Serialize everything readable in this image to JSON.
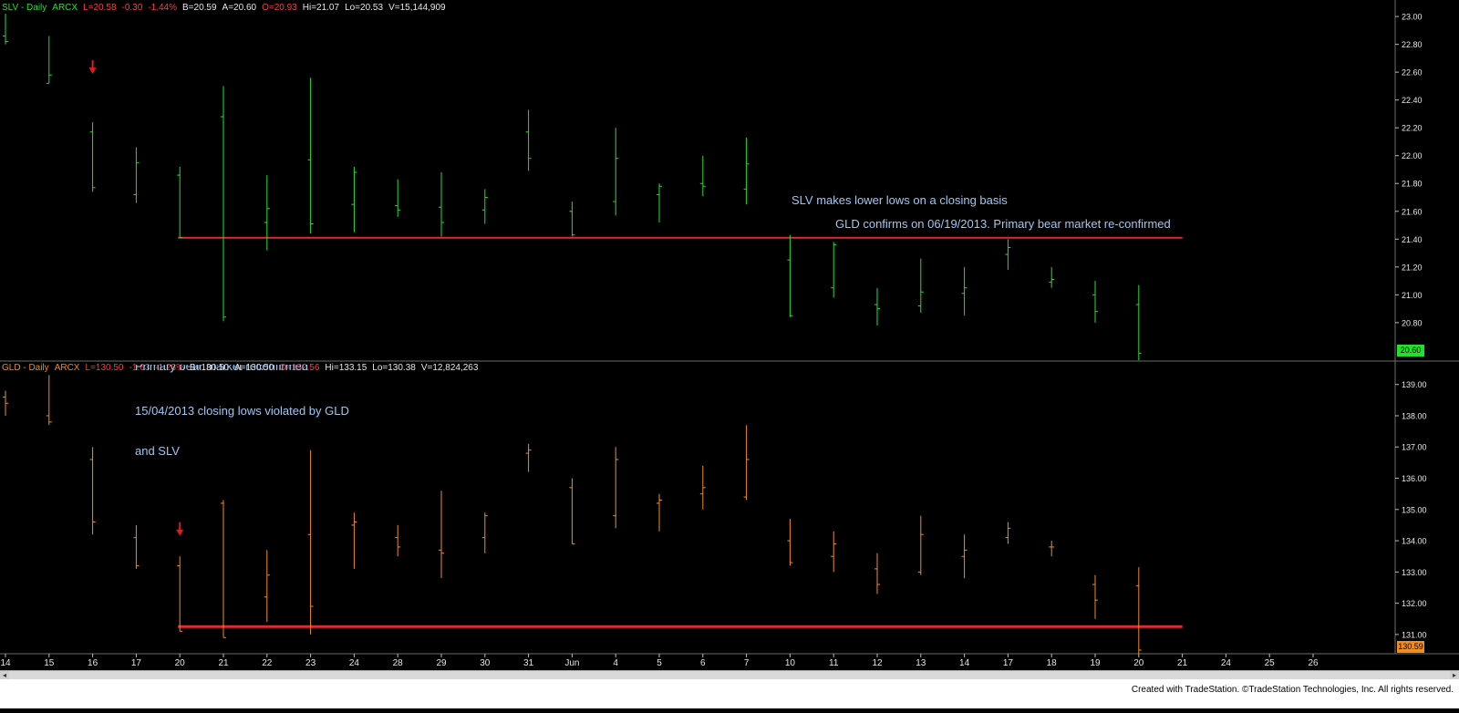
{
  "colors": {
    "background": "#000000",
    "slv_bar": "#23e02a",
    "gld_bar": "#f28c1e",
    "support_line": "#e12b2b",
    "arrow": "#e01b1b",
    "annotation": "#9fc7f2",
    "axis_text": "#e6e6e6",
    "grid": "#1f1f1f",
    "slv_tag": "#23e02a",
    "gld_tag": "#f28c1e"
  },
  "slv_header": {
    "symbol": "SLV - Daily",
    "exchange": "ARCX",
    "last": "L=20.58",
    "change": "-0.30",
    "pct": "-1.44%",
    "bid": "B=20.59",
    "ask": "A=20.60",
    "open": "O=20.93",
    "high": "Hi=21.07",
    "low": "Lo=20.53",
    "volume": "V=15,144,909"
  },
  "gld_header": {
    "symbol": "GLD - Daily",
    "exchange": "ARCX",
    "last": "L=130.50",
    "change": "-1.63",
    "pct": "-1.23%",
    "bid": "B=130.50",
    "ask": "A=130.50",
    "open": "O=132.56",
    "high": "Hi=133.15",
    "low": "Lo=130.38",
    "volume": "V=12,824,263"
  },
  "annotations": {
    "slv_line1": "SLV makes lower lows on a closing basis",
    "slv_line2": "GLD confirms on 06/19/2013. Primary bear market re-confirmed",
    "gld_line0": "Primary bear market reconfirmed",
    "gld_line1": "15/04/2013 closing lows violated by GLD",
    "gld_line2": "and SLV"
  },
  "price_tags": {
    "slv": "20.60",
    "gld": "130.59"
  },
  "footer": {
    "credit": "Created with TradeStation. ©TradeStation Technologies, Inc. All rights reserved."
  },
  "chart_data": [
    {
      "type": "ohlc",
      "symbol": "SLV - Daily",
      "x_labels": [
        "14",
        "15",
        "16",
        "17",
        "20",
        "21",
        "22",
        "23",
        "24",
        "28",
        "29",
        "30",
        "31",
        "Jun",
        "4",
        "5",
        "6",
        "7",
        "10",
        "11",
        "12",
        "13",
        "14",
        "17",
        "18",
        "19",
        "20",
        "21",
        "24",
        "25",
        "26"
      ],
      "y_ticks": [
        20.8,
        21.0,
        21.2,
        21.4,
        21.6,
        21.8,
        22.0,
        22.2,
        22.4,
        22.6,
        22.8,
        23.0
      ],
      "ylim": [
        20.55,
        23.04
      ],
      "bars": [
        {
          "x": 0,
          "o": 22.86,
          "h": 23.02,
          "l": 22.8,
          "c": 22.82
        },
        {
          "x": 1,
          "o": 22.52,
          "h": 22.86,
          "l": 22.52,
          "c": 22.58
        },
        {
          "x": 2,
          "o": 22.17,
          "h": 22.24,
          "l": 21.74,
          "c": 21.77
        },
        {
          "x": 3,
          "o": 21.72,
          "h": 22.06,
          "l": 21.66,
          "c": 21.95
        },
        {
          "x": 4,
          "o": 21.86,
          "h": 21.92,
          "l": 21.41,
          "c": 21.41
        },
        {
          "x": 5,
          "o": 22.28,
          "h": 22.5,
          "l": 20.81,
          "c": 20.84
        },
        {
          "x": 6,
          "o": 21.52,
          "h": 21.86,
          "l": 21.32,
          "c": 21.62
        },
        {
          "x": 7,
          "o": 21.97,
          "h": 22.56,
          "l": 21.44,
          "c": 21.51
        },
        {
          "x": 8,
          "o": 21.65,
          "h": 21.92,
          "l": 21.45,
          "c": 21.88
        },
        {
          "x": 9,
          "o": 21.64,
          "h": 21.83,
          "l": 21.56,
          "c": 21.61
        },
        {
          "x": 10,
          "o": 21.63,
          "h": 21.88,
          "l": 21.42,
          "c": 21.52
        },
        {
          "x": 11,
          "o": 21.61,
          "h": 21.76,
          "l": 21.51,
          "c": 21.7
        },
        {
          "x": 12,
          "o": 22.17,
          "h": 22.33,
          "l": 21.89,
          "c": 21.98
        },
        {
          "x": 13,
          "o": 21.6,
          "h": 21.67,
          "l": 21.42,
          "c": 21.43
        },
        {
          "x": 14,
          "o": 21.67,
          "h": 22.2,
          "l": 21.57,
          "c": 21.98
        },
        {
          "x": 15,
          "o": 21.72,
          "h": 21.8,
          "l": 21.52,
          "c": 21.78
        },
        {
          "x": 16,
          "o": 21.8,
          "h": 22.0,
          "l": 21.71,
          "c": 21.78
        },
        {
          "x": 17,
          "o": 21.76,
          "h": 22.13,
          "l": 21.65,
          "c": 21.94
        },
        {
          "x": 18,
          "o": 21.25,
          "h": 21.43,
          "l": 20.84,
          "c": 20.85
        },
        {
          "x": 19,
          "o": 21.05,
          "h": 21.38,
          "l": 20.98,
          "c": 21.36
        },
        {
          "x": 20,
          "o": 20.93,
          "h": 21.05,
          "l": 20.78,
          "c": 20.9
        },
        {
          "x": 21,
          "o": 20.92,
          "h": 21.26,
          "l": 20.87,
          "c": 21.02
        },
        {
          "x": 22,
          "o": 21.01,
          "h": 21.2,
          "l": 20.85,
          "c": 21.05
        },
        {
          "x": 23,
          "o": 21.29,
          "h": 21.4,
          "l": 21.18,
          "c": 21.34
        },
        {
          "x": 24,
          "o": 21.09,
          "h": 21.2,
          "l": 21.05,
          "c": 21.11
        },
        {
          "x": 25,
          "o": 21.0,
          "h": 21.1,
          "l": 20.8,
          "c": 20.88
        },
        {
          "x": 26,
          "o": 20.93,
          "h": 21.07,
          "l": 20.53,
          "c": 20.58
        }
      ],
      "support_level": 21.41,
      "support_from_x": 4,
      "support_to_x": 27,
      "arrow_at_x": 2,
      "arrow_price": 22.62
    },
    {
      "type": "ohlc",
      "symbol": "GLD - Daily",
      "x_labels": [
        "14",
        "15",
        "16",
        "17",
        "20",
        "21",
        "22",
        "23",
        "24",
        "28",
        "29",
        "30",
        "31",
        "Jun",
        "4",
        "5",
        "6",
        "7",
        "10",
        "11",
        "12",
        "13",
        "14",
        "17",
        "18",
        "19",
        "20",
        "21",
        "24",
        "25",
        "26"
      ],
      "y_ticks": [
        131.0,
        132.0,
        133.0,
        134.0,
        135.0,
        136.0,
        137.0,
        138.0,
        139.0
      ],
      "ylim": [
        130.5,
        139.4
      ],
      "bars": [
        {
          "x": 0,
          "o": 138.6,
          "h": 138.8,
          "l": 138.0,
          "c": 138.4
        },
        {
          "x": 1,
          "o": 138.0,
          "h": 139.3,
          "l": 137.7,
          "c": 137.8
        },
        {
          "x": 2,
          "o": 136.6,
          "h": 137.0,
          "l": 134.2,
          "c": 134.6
        },
        {
          "x": 3,
          "o": 134.1,
          "h": 134.5,
          "l": 133.1,
          "c": 133.2
        },
        {
          "x": 4,
          "o": 133.2,
          "h": 133.5,
          "l": 131.1,
          "c": 131.1
        },
        {
          "x": 5,
          "o": 135.2,
          "h": 135.3,
          "l": 130.9,
          "c": 130.9
        },
        {
          "x": 6,
          "o": 132.2,
          "h": 133.7,
          "l": 131.4,
          "c": 132.9
        },
        {
          "x": 7,
          "o": 134.2,
          "h": 136.9,
          "l": 131.0,
          "c": 131.9
        },
        {
          "x": 8,
          "o": 134.5,
          "h": 134.9,
          "l": 133.1,
          "c": 134.6
        },
        {
          "x": 9,
          "o": 134.1,
          "h": 134.5,
          "l": 133.5,
          "c": 133.8
        },
        {
          "x": 10,
          "o": 133.7,
          "h": 135.6,
          "l": 132.8,
          "c": 133.6
        },
        {
          "x": 11,
          "o": 134.1,
          "h": 134.9,
          "l": 133.6,
          "c": 134.8
        },
        {
          "x": 12,
          "o": 136.8,
          "h": 137.1,
          "l": 136.2,
          "c": 136.9
        },
        {
          "x": 13,
          "o": 135.7,
          "h": 136.0,
          "l": 133.9,
          "c": 133.9
        },
        {
          "x": 14,
          "o": 134.8,
          "h": 137.0,
          "l": 134.4,
          "c": 136.6
        },
        {
          "x": 15,
          "o": 135.2,
          "h": 135.5,
          "l": 134.3,
          "c": 135.3
        },
        {
          "x": 16,
          "o": 135.5,
          "h": 136.4,
          "l": 135.0,
          "c": 135.7
        },
        {
          "x": 17,
          "o": 135.4,
          "h": 137.7,
          "l": 135.3,
          "c": 136.6
        },
        {
          "x": 18,
          "o": 134.0,
          "h": 134.7,
          "l": 133.2,
          "c": 133.3
        },
        {
          "x": 19,
          "o": 133.5,
          "h": 134.3,
          "l": 133.0,
          "c": 133.9
        },
        {
          "x": 20,
          "o": 133.1,
          "h": 133.6,
          "l": 132.3,
          "c": 132.6
        },
        {
          "x": 21,
          "o": 133.0,
          "h": 134.8,
          "l": 132.9,
          "c": 134.2
        },
        {
          "x": 22,
          "o": 133.5,
          "h": 134.2,
          "l": 132.8,
          "c": 133.7
        },
        {
          "x": 23,
          "o": 134.1,
          "h": 134.6,
          "l": 133.9,
          "c": 134.4
        },
        {
          "x": 24,
          "o": 133.8,
          "h": 134.0,
          "l": 133.5,
          "c": 133.8
        },
        {
          "x": 25,
          "o": 132.6,
          "h": 132.9,
          "l": 131.5,
          "c": 132.1
        },
        {
          "x": 26,
          "o": 132.56,
          "h": 133.15,
          "l": 130.38,
          "c": 130.5
        }
      ],
      "support_level": 131.25,
      "support_from_x": 4,
      "support_to_x": 27,
      "arrow_at_x": 4,
      "arrow_price": 134.3
    }
  ]
}
